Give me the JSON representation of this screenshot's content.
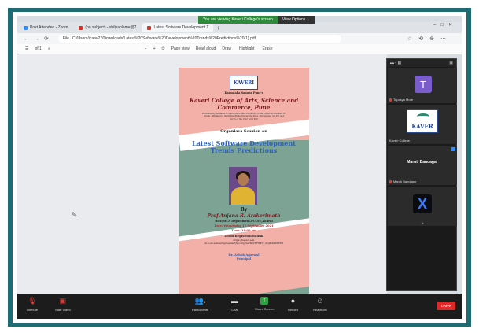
{
  "share_banner": {
    "viewing": "You are viewing Kaveri College's screen",
    "options": "View Options ⌄"
  },
  "tabs": [
    {
      "label": "Post Attendee - Zoom",
      "color": "#2d8cff"
    },
    {
      "label": "(no subject) - shilpaolame@7",
      "color": "#d93025"
    },
    {
      "label": "Latest Software Development T",
      "color": "#d93025"
    }
  ],
  "address": {
    "url": "C:/Users/icaav27/Downloads/Latest%20Software%20Development%20Trends%20Predictions%20(1).pdf",
    "file_label": "File"
  },
  "pdf_toolbar": {
    "page": "of 1",
    "page_view": "Page view",
    "read_aloud": "Read aloud",
    "draw": "Draw",
    "highlight": "Highlight",
    "erase": "Erase"
  },
  "poster": {
    "logo": "KAVERI",
    "society": "Karnataka Sangha Pune's",
    "college": "Kaveri College of Arts, Science and Commerce, Pune",
    "affiliation": "Permanently Affiliated to Savitribai Phule University, Pune. NAAC Accredited 'B' Grade. Affiliated to Savitribai Phule University, Pune. Recognized u/s 2(f) and 12(B) of the UGC Act 1956",
    "organises": "Organises Session on",
    "title": "Latest Software Development Trends Predictions",
    "by": "By",
    "speaker": "Prof.Anjana R. Arakerimath",
    "dept": "HOD,MCA Department,PCCoE,Akurdi",
    "date": "Date: Wednesday 15 September 2021",
    "time": "Time: 11:00 am",
    "zoom": "Zoom Registration link",
    "link1": "https://kaveri.edu",
    "link2": "us.zoom.us/meeting/register/tJwoce0pjzwsHdYCHFWP1T_i2Uj8nDb5XWNB",
    "principal_name": "Dr. Ashok Agarwal",
    "principal": "Principal"
  },
  "panel": {
    "participants": [
      {
        "initial": "T",
        "name": "Tapasya More"
      },
      {
        "name": "Kaveri College",
        "logo": "KAVER"
      },
      {
        "name": "Maruti Bandagar",
        "center": "Maruti Bandagar"
      },
      {
        "name": "",
        "logo": "X"
      }
    ]
  },
  "zoom_toolbar": {
    "unmute": "Unmute",
    "start_video": "Start Video",
    "participants": "Participants",
    "participants_count": "8",
    "chat": "Chat",
    "share_screen": "Share Screen",
    "record": "Record",
    "reactions": "Reactions",
    "leave": "Leave"
  }
}
